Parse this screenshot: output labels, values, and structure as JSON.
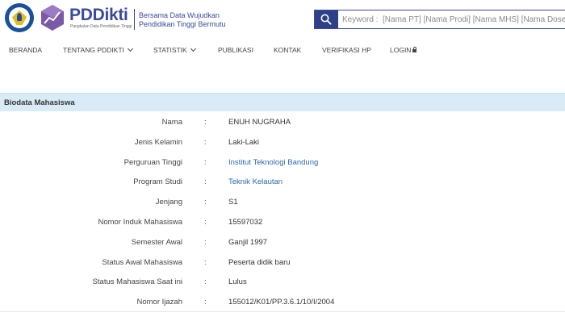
{
  "brand": {
    "name": "PDDikti",
    "tagline": "Pangkalan Data Pendidikan Tinggi",
    "slogan_line1": "Bersama Data Wujudkan",
    "slogan_line2": "Pendidikan Tinggi Bermutu"
  },
  "search": {
    "placeholder": "Keyword :  [Nama PT] [Nama Prodi] [Nama MHS] [Nama Dosen] [NIM]"
  },
  "nav": {
    "items": [
      {
        "label": "BERANDA"
      },
      {
        "label": "TENTANG PDDIKTI"
      },
      {
        "label": "STATISTIK"
      },
      {
        "label": "PUBLIKASI"
      },
      {
        "label": "KONTAK"
      },
      {
        "label": "VERIFIKASI HP"
      },
      {
        "label": "LOGIN"
      }
    ]
  },
  "section": {
    "title": "Biodata Mahasiswa"
  },
  "biodata": [
    {
      "label": "Nama",
      "value": "ENUH NUGRAHA"
    },
    {
      "label": "Jenis Kelamin",
      "value": "Laki-Laki"
    },
    {
      "label": "Perguruan Tinggi",
      "value": "Institut Teknologi Bandung"
    },
    {
      "label": "Program Studi",
      "value": "Teknik Kelautan"
    },
    {
      "label": "Jenjang",
      "value": "S1"
    },
    {
      "label": "Nomor Induk Mahasiswa",
      "value": "15597032"
    },
    {
      "label": "Semester Awal",
      "value": "Ganjil 1997"
    },
    {
      "label": "Status Awal Mahasiswa",
      "value": "Peserta didik baru"
    },
    {
      "label": "Status Mahasiswa Saat ini",
      "value": "Lulus"
    },
    {
      "label": "Nomor Ijazah",
      "value": "155012/K01/PP.3.6.1/10/I/2004"
    }
  ],
  "separator": ":",
  "colors": {
    "brand": "#3b4b9b",
    "search_button": "#2e4088",
    "section_bar": "#d8ebf6",
    "link": "#2a6bb0"
  }
}
